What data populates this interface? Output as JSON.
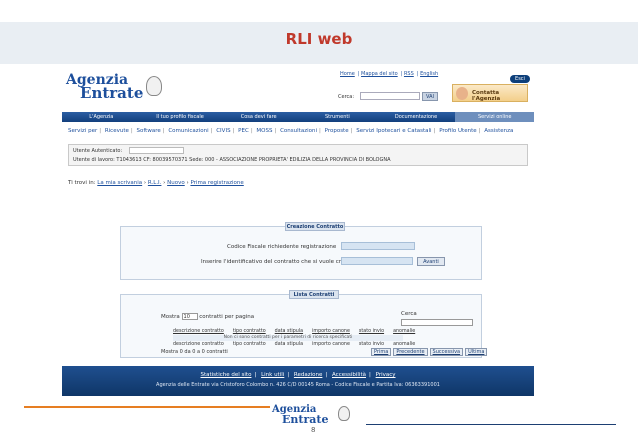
{
  "slide": {
    "title": "RLI web",
    "page_number": "8"
  },
  "colors": {
    "title": "#c0392b",
    "nav_blue": "#123f7d",
    "accent_orange": "#e67e22"
  },
  "site": {
    "logo_line1": "genzia",
    "logo_line2": "ntrate",
    "logo_cap1": "A",
    "logo_cap2": "E",
    "top_links": [
      "Home",
      "Mappa del sito",
      "RSS",
      "English"
    ],
    "exit_label": "Esci",
    "search_label": "Cerca:",
    "search_button": "VAI",
    "contact_label": "Contatta l'Agenzia",
    "main_nav": [
      "L'Agenzia",
      "Il tuo profilo fiscale",
      "Cosa devi fare",
      "Strumenti",
      "Documentazione",
      "Servizi online"
    ],
    "sub_nav": [
      "Servizi per",
      "Ricevute",
      "Software",
      "Comunicazioni",
      "CIVIS",
      "PEC",
      "MOSS",
      "Consultazioni",
      "Proposte",
      "Servizi Ipotecari e Catastali",
      "Profilo Utente",
      "Assistenza"
    ],
    "user": {
      "auth_label": "Utente Autenticato:",
      "line2": "Utente di lavoro: T1043613 CF: 80039570371 Sede: 000 - ASSOCIAZIONE PROPRIETA' EDILIZIA DELLA PROVINCIA DI BOLOGNA"
    },
    "breadcrumb": {
      "prefix": "Ti trovi in:",
      "items": [
        "La mia scrivania",
        "R.L.I.",
        "Nuovo",
        "Prima registrazione"
      ]
    },
    "create_panel": {
      "title": "Creazione Contratto",
      "field1_label": "Codice Fiscale richiedente registrazione",
      "field2_label": "Inserire l'identificativo del contratto che si vuole creare",
      "button": "Avanti"
    },
    "list_panel": {
      "title": "Lista Contratti",
      "show_prefix": "Mostra",
      "show_value": "10",
      "show_suffix": "contratti per pagina",
      "search_label": "Cerca",
      "columns": [
        "descrizione contratto",
        "tipo contratto",
        "data stipula",
        "importo canone",
        "stato invio",
        "anomalie"
      ],
      "empty_message": "Non ci sono contratti per i parametri di ricerca specificati",
      "info": "Mostra 0 da 0 a 0 contratti",
      "pager": [
        "Prima",
        "Precedente",
        "Successiva",
        "Ultima"
      ]
    },
    "footer": {
      "links": [
        "Statistiche del sito",
        "Link utili",
        "Redazione",
        "Accessibilità",
        "Privacy"
      ],
      "address": "Agenzia delle Entrate via Cristoforo Colombo n. 426 C/D 00145 Roma - Codice Fiscale e Partita Iva: 06363391001"
    }
  }
}
